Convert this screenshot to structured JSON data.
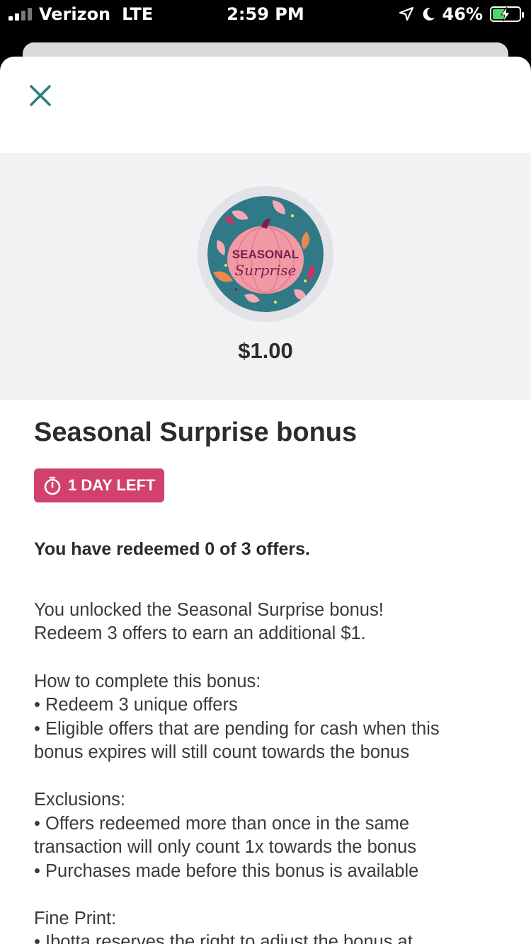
{
  "status_bar": {
    "carrier": "Verizon",
    "network": "LTE",
    "time": "2:59 PM",
    "battery_percent": "46%",
    "battery_level": 0.46,
    "icons": [
      "signal-icon",
      "location-arrow-icon",
      "moon-icon",
      "battery-charging-icon"
    ]
  },
  "modal": {
    "close_icon": "close-icon",
    "badge": {
      "line1": "SEASONAL",
      "line2": "Surprise"
    },
    "amount": "$1.00",
    "title": "Seasonal Surprise bonus",
    "days_left": "1 DAY LEFT",
    "timer_icon": "stopwatch-icon",
    "redeemed_text": "You have redeemed 0 of 3 offers.",
    "paragraphs": [
      [
        "You unlocked the Seasonal Surprise bonus!",
        "Redeem 3 offers to earn an additional $1."
      ],
      [
        "How to complete this bonus:",
        "• Redeem 3 unique offers",
        "• Eligible offers that are pending for cash when this",
        "bonus expires will still count towards the bonus"
      ],
      [
        "Exclusions:",
        "• Offers redeemed more than once in the same",
        "transaction will only count 1x towards the bonus",
        "• Purchases made before this bonus is available"
      ],
      [
        "Fine Print:",
        "• Ibotta reserves the right to adjust the bonus at"
      ]
    ]
  },
  "colors": {
    "accent_pink": "#d0416b",
    "close_teal": "#2e7d86",
    "badge_teal": "#2f7a86",
    "pumpkin_pink": "#f19aa6",
    "badge_text_purple": "#7a1f4f"
  }
}
